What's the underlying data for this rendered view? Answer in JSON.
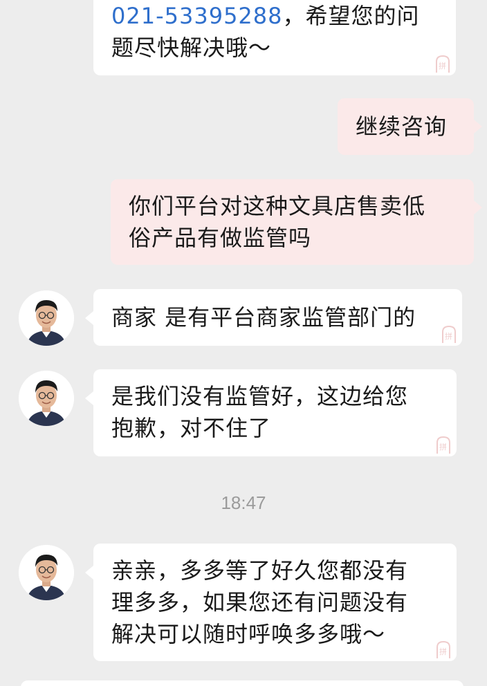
{
  "messages": [
    {
      "id": "m1",
      "direction": "incoming",
      "phone": "021-53395288",
      "after_phone": "，希望您的问",
      "line2": "题尽快解决哦～"
    },
    {
      "id": "m2",
      "direction": "outgoing",
      "text": "继续咨询"
    },
    {
      "id": "m3",
      "direction": "outgoing",
      "line1": "你们平台对这种文具店售卖低",
      "line2": "俗产品有做监管吗"
    },
    {
      "id": "m4",
      "direction": "incoming",
      "text": "商家 是有平台商家监管部门的"
    },
    {
      "id": "m5",
      "direction": "incoming",
      "line1": "是我们没有监管好，这边给您",
      "line2": "抱歉，对不住了"
    },
    {
      "id": "m6",
      "direction": "incoming",
      "line1": "亲亲，多多等了好久您都没有",
      "line2": "理多多，如果您还有问题没有",
      "line3": "解决可以随时呼唤多多哦～"
    }
  ],
  "timestamp": "18:47",
  "colors": {
    "background": "#ededed",
    "incoming_bubble": "#ffffff",
    "outgoing_bubble": "#fbe9e9",
    "link": "#2f6fcc",
    "timestamp": "#9b9b9b",
    "stamp": "#e2a3a3"
  },
  "icons": {
    "avatar": "agent-avatar-icon",
    "stamp": "pin-stamp-icon"
  }
}
